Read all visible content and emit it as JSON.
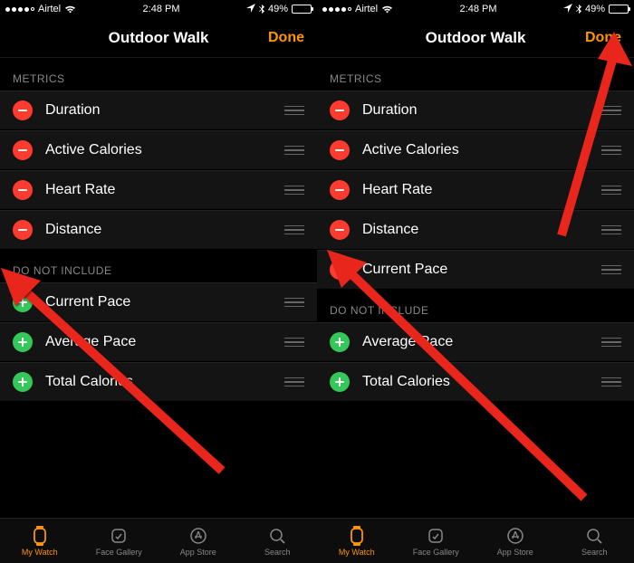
{
  "status": {
    "carrier": "Airtel",
    "time": "2:48 PM",
    "battery_pct": "49%"
  },
  "nav": {
    "title": "Outdoor Walk",
    "done": "Done"
  },
  "sections": {
    "metrics_header": "METRICS",
    "do_not_include_header": "DO NOT INCLUDE"
  },
  "left": {
    "metrics": [
      "Duration",
      "Active Calories",
      "Heart Rate",
      "Distance"
    ],
    "excluded": [
      "Current Pace",
      "Average Pace",
      "Total Calories"
    ]
  },
  "right": {
    "metrics": [
      "Duration",
      "Active Calories",
      "Heart Rate",
      "Distance",
      "Current Pace"
    ],
    "excluded": [
      "Average Pace",
      "Total Calories"
    ]
  },
  "tabs": {
    "my_watch": "My Watch",
    "face_gallery": "Face Gallery",
    "app_store": "App Store",
    "search": "Search"
  }
}
